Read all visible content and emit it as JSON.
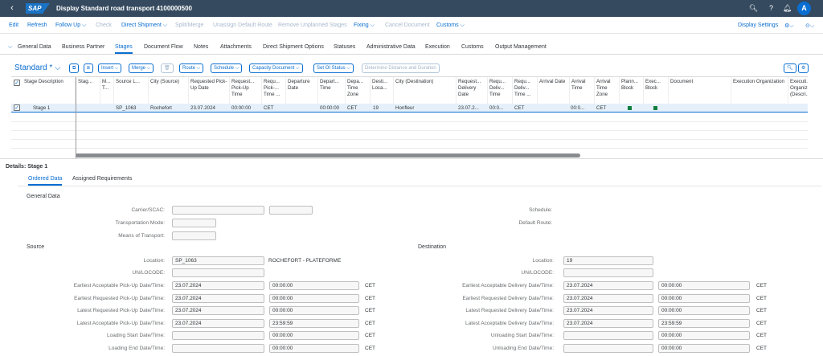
{
  "shell": {
    "back": "‹",
    "logo": "SAP",
    "title": "Display Standard road transport 4100000500",
    "avatar": "A"
  },
  "toolbar": {
    "items": [
      "Edit",
      "Refresh",
      "Follow Up ⌵",
      "Check",
      "Direct Shipment ⌵",
      "Split/Merge",
      "Unassign Default Route",
      "Remove Unplanned Stages",
      "Fixing ⌵",
      "Cancel Document",
      "Customs ⌵"
    ],
    "display_settings": "Display Settings"
  },
  "tabs": [
    "General Data",
    "Business Partner",
    "Stages",
    "Document Flow",
    "Notes",
    "Attachments",
    "Direct Shipment Options",
    "Statuses",
    "Administrative Data",
    "Execution",
    "Customs",
    "Output Management"
  ],
  "table_toolbar": {
    "variant": "Standard *",
    "insert": "Insert",
    "merge": "Merge",
    "route": "Route",
    "schedule": "Schedule",
    "capacity": "Capacity Document",
    "set_oi": "Set OI Status",
    "determine": "Determine Distance and Duration"
  },
  "grid": {
    "headers": [
      "Stage Description",
      "Stag...",
      "M... T...",
      "Source L...",
      "City (Source)",
      "Requested Pick-Up Date",
      "Request... Pick-Up Time",
      "Requ... Pick-... Time ...",
      "Departure Date",
      "Depart... Time",
      "Depa... Time Zone",
      "Desti... Loca...",
      "City (Destination)",
      "Request... Delivery Date",
      "Requ... Deliv... Time",
      "Requ... Deliv... Time ...",
      "Arrival Date",
      "Arrival Time",
      "Arrival Time Zone",
      "Plann... Block",
      "Exec... Block",
      "Document",
      "Execution Organization",
      "Executi... Organiz... (Descri..."
    ],
    "row": {
      "stage": "Stage 1",
      "source": "SP_1063",
      "city_source": "Rochefort",
      "pickup_date": "23.07.2024",
      "pickup_time": "00:00:00",
      "pickup_tz": "CET",
      "dep_time": "00:00:00",
      "dep_tz": "CET",
      "dest": "19",
      "city_dest": "Honfleur",
      "delivery_date": "23.07.2...",
      "delivery_time": "00:0...",
      "delivery_tz": "CET",
      "arrival_time": "00:0...",
      "arrival_tz": "CET"
    }
  },
  "details": {
    "title": "Details: Stage 1",
    "tabs": [
      "Ordered Data",
      "Assigned Requirements"
    ],
    "general": {
      "title": "General Data",
      "carrier": "Carrier/SCAC:",
      "transport_mode": "Transportation Mode:",
      "means": "Means of Transport:",
      "schedule": "Schedule:",
      "default_route": "Default Route:"
    },
    "source": {
      "title": "Source",
      "location_label": "Location:",
      "location": "SP_1063",
      "location_desc": "ROCHEFORT - PLATEFORME",
      "unlocode": "UN/LOCODE:",
      "l1": "Earliest Acceptable Pick-Up Date/Time:",
      "d1": "23.07.2024",
      "t1": "00:00:00",
      "l2": "Earliest Requested Pick-Up Date/Time:",
      "d2": "23.07.2024",
      "t2": "00:00:00",
      "l3": "Latest Requested Pick-Up Date/Time:",
      "d3": "23.07.2024",
      "t3": "00:00:00",
      "l4": "Latest Acceptable Pick-Up Date/Time:",
      "d4": "23.07.2024",
      "t4": "23:59:59",
      "l5": "Loading Start Date/Time:",
      "t5": "00:00:00",
      "l6": "Loading End Date/Time:",
      "t6": "00:00:00",
      "tz": "CET"
    },
    "destination": {
      "title": "Destination",
      "location_label": "Location:",
      "location": "19",
      "unlocode": "UN/LOCODE:",
      "l1": "Earliest Acceptable Delivery Date/Time:",
      "d1": "23.07.2024",
      "t1": "00:00:00",
      "l2": "Earliest Requested Delivery Date/Time:",
      "d2": "23.07.2024",
      "t2": "00:00:00",
      "l3": "Latest Requested Delivery Date/Time:",
      "d3": "23.07.2024",
      "t3": "00:00:00",
      "l4": "Latest Acceptable Delivery Date/Time:",
      "d4": "23.07.2024",
      "t4": "23:59:59",
      "l5": "Unloading Start Date/Time:",
      "t5": "00:00:00",
      "l6": "Unloading End Date/Time:",
      "t6": "00:00:00",
      "tz": "CET"
    }
  }
}
